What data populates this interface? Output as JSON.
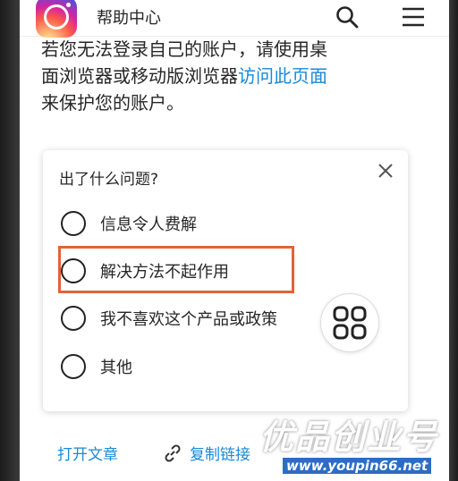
{
  "header": {
    "title": "帮助中心",
    "logo_icon": "instagram-logo-icon",
    "search_icon": "search-icon",
    "menu_icon": "hamburger-menu-icon"
  },
  "intro": {
    "line1": "若您无法登录自己的账户，请使用桌",
    "line2_prefix": "面浏览器或移动版浏览器",
    "line2_link": "访问此页面",
    "line3": "来保护您的账户。"
  },
  "feedback": {
    "title": "出了什么问题?",
    "options": [
      {
        "label": "信息令人费解"
      },
      {
        "label": "解决方法不起作用"
      },
      {
        "label": "我不喜欢这个产品或政策"
      },
      {
        "label": "其他"
      }
    ],
    "highlighted_index": 1
  },
  "footer": {
    "open_article": "打开文章",
    "copy_link": "复制链接"
  },
  "watermark": {
    "brand": "优品创业号",
    "url": "www.youpin66.net"
  },
  "colors": {
    "link": "#1a8ad6",
    "highlight": "#e0633b"
  }
}
